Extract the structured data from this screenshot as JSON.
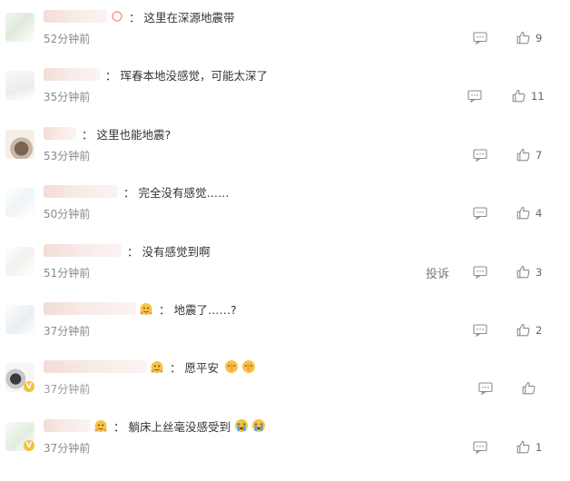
{
  "comments": [
    {
      "name": "",
      "separator": "：",
      "text": "这里在深源地震带",
      "time": "52分钟前",
      "likes": "9"
    },
    {
      "name": "",
      "separator": "：",
      "text": "珲春本地没感觉，可能太深了",
      "time": "35分钟前",
      "likes": "11"
    },
    {
      "name": "",
      "separator": "：",
      "text": "这里也能地震?",
      "time": "53分钟前",
      "likes": "7"
    },
    {
      "name": "",
      "separator": "：",
      "text": "完全没有感觉……",
      "time": "50分钟前",
      "likes": "4"
    },
    {
      "name": "",
      "separator": "：",
      "text": "没有感觉到啊",
      "time": "51分钟前",
      "likes": "3",
      "report": "投诉"
    },
    {
      "name": "",
      "separator": "：",
      "text": "地震了……?",
      "time": "37分钟前",
      "likes": "2"
    },
    {
      "name": "",
      "separator": "：",
      "text": "愿平安",
      "time": "37分钟前",
      "likes": ""
    },
    {
      "name": "",
      "separator": "：",
      "text": "躺床上丝毫没感受到",
      "time": "37分钟前",
      "likes": "1"
    }
  ],
  "icons": {
    "reply": "comment-bubble-icon",
    "like": "thumbs-up-icon",
    "fan": "fan-badge-icon",
    "emoji_pray": "pray-emoji-icon",
    "emoji_cry": "crying-emoji-icon"
  },
  "colors": {
    "time": "#8a8a8a",
    "text": "#333333",
    "icon": "#8c8c8c"
  }
}
